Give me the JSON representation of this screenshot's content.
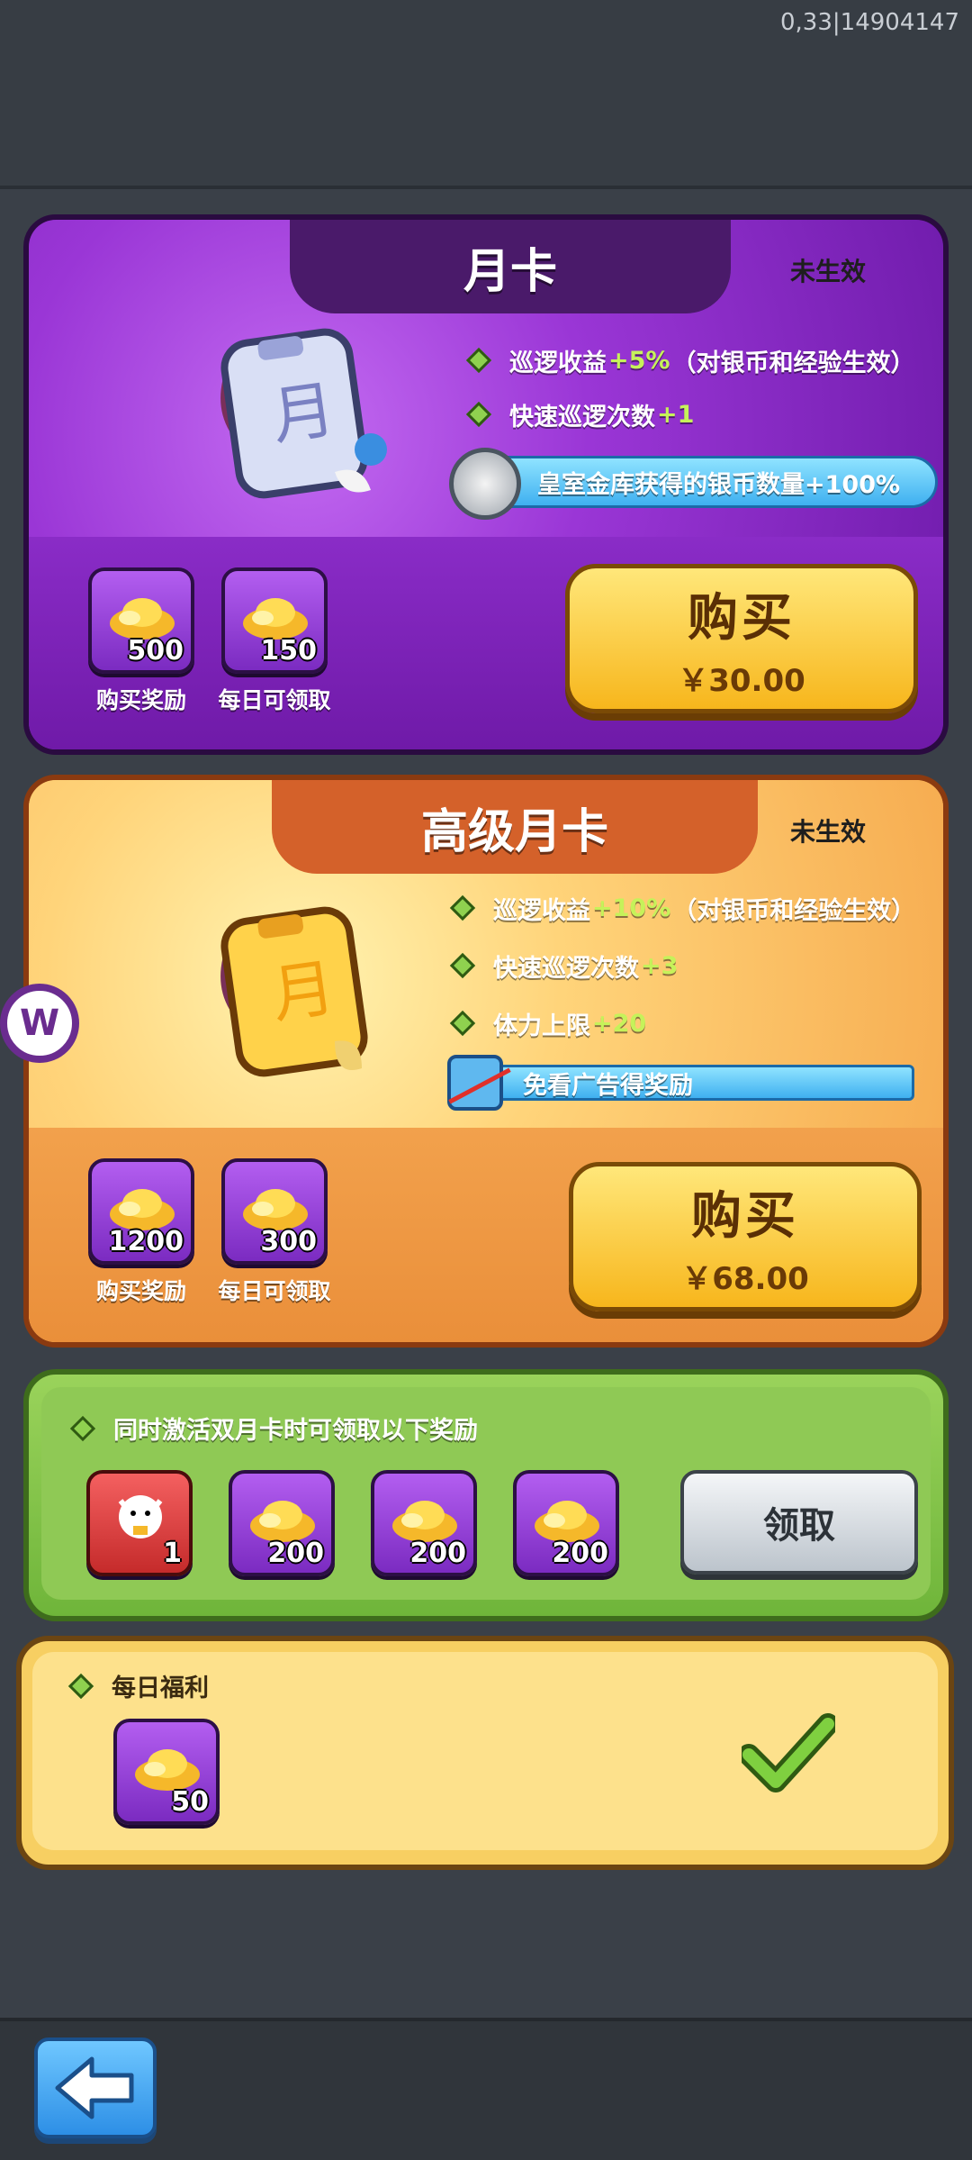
{
  "debug": {
    "text": "0,33|14904147"
  },
  "monthly": {
    "title": "月卡",
    "status": "未生效",
    "perks": [
      {
        "pre": "巡逻收益",
        "hl": "+5%",
        "post": "（对银币和经验生效）"
      },
      {
        "pre": "快速巡逻次数",
        "hl": "+1",
        "post": ""
      }
    ],
    "banner": "皇室金库获得的银币数量+100%",
    "items": [
      {
        "count": "500",
        "caption": "购买奖励"
      },
      {
        "count": "150",
        "caption": "每日可领取"
      }
    ],
    "buy_label": "购买",
    "price": "￥30.00"
  },
  "premium": {
    "title": "高级月卡",
    "status": "未生效",
    "perks": [
      {
        "pre": "巡逻收益",
        "hl": "+10%",
        "post": "（对银币和经验生效）"
      },
      {
        "pre": "快速巡逻次数",
        "hl": "+3",
        "post": ""
      },
      {
        "pre": "体力上限",
        "hl": "+20",
        "post": ""
      }
    ],
    "banner": "免看广告得奖励",
    "items": [
      {
        "count": "1200",
        "caption": "购买奖励"
      },
      {
        "count": "300",
        "caption": "每日可领取"
      }
    ],
    "buy_label": "购买",
    "price": "￥68.00"
  },
  "double": {
    "header": "同时激活双月卡时可领取以下奖励",
    "items": [
      {
        "count": "1"
      },
      {
        "count": "200"
      },
      {
        "count": "200"
      },
      {
        "count": "200"
      }
    ],
    "claim_label": "领取"
  },
  "daily": {
    "header": "每日福利",
    "item_count": "50"
  },
  "colors": {
    "purple": "#9a36d6",
    "orange": "#f5a64a",
    "green": "#8fc955",
    "gold": "#f7b61c"
  },
  "icons": {
    "back": "back-arrow-icon",
    "check": "check-icon",
    "ingot": "gold-ingot-icon"
  }
}
